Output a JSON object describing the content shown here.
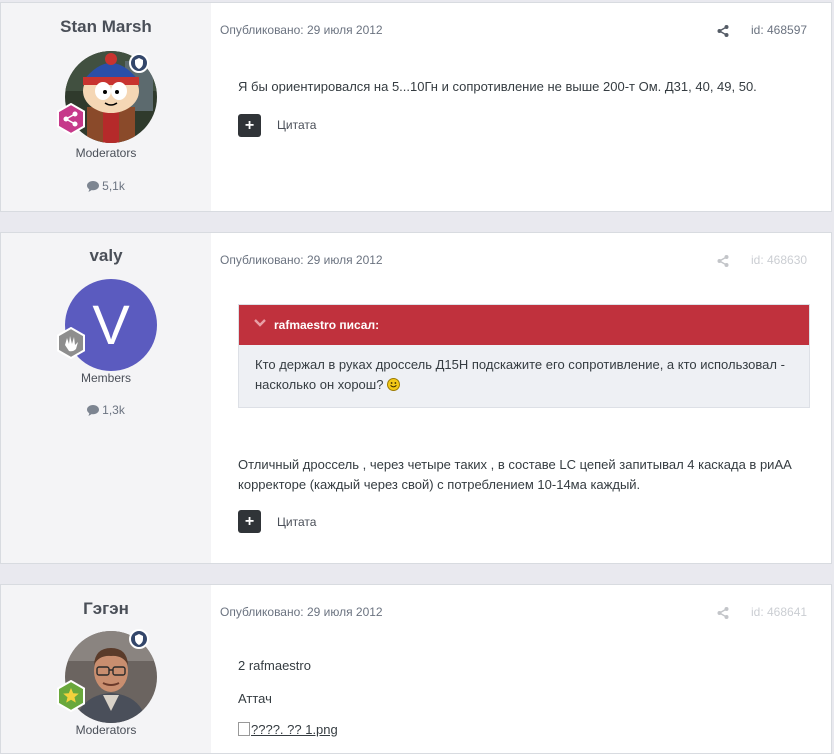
{
  "posts": [
    {
      "author": "Stan Marsh",
      "group": "Moderators",
      "post_count": "5,1k",
      "date": "Опубликовано: 29 июля 2012",
      "id": "id: 468597",
      "body": "Я бы ориентировался на 5...10Гн и сопротивление не выше 200-т Ом. Д31, 40, 49, 50.",
      "quote_label": "Цитата"
    },
    {
      "author": "valy",
      "avatar_letter": "V",
      "group": "Members",
      "post_count": "1,3k",
      "date": "Опубликовано: 29 июля 2012",
      "id": "id: 468630",
      "quote": {
        "author": "rafmaestro писал:",
        "text": "Кто держал в руках дроссель Д15Н подскажите его сопротивление, а кто использовал - насколько он хорош?"
      },
      "body": "Отличный дроссель , через четыре таких , в составе LC цепей запитывал 4 каскада в риАА корректоре (каждый через свой) с потреблением 10-14ма каждый.",
      "quote_label": "Цитата"
    },
    {
      "author": "Гэгэн",
      "group": "Moderators",
      "date": "Опубликовано: 29 июля 2012",
      "id": "id: 468641",
      "line1": "2 rafmaestro",
      "line2": "Аттач",
      "image_alt": "????. ?? 1.png"
    }
  ],
  "colors": {
    "quote_header": "#c0313d",
    "moderator_badge": "#33466a",
    "stan_rank": "#c6398a",
    "valy_avatar": "#5b5bbf",
    "gagen_rank": "#6aa83c"
  }
}
